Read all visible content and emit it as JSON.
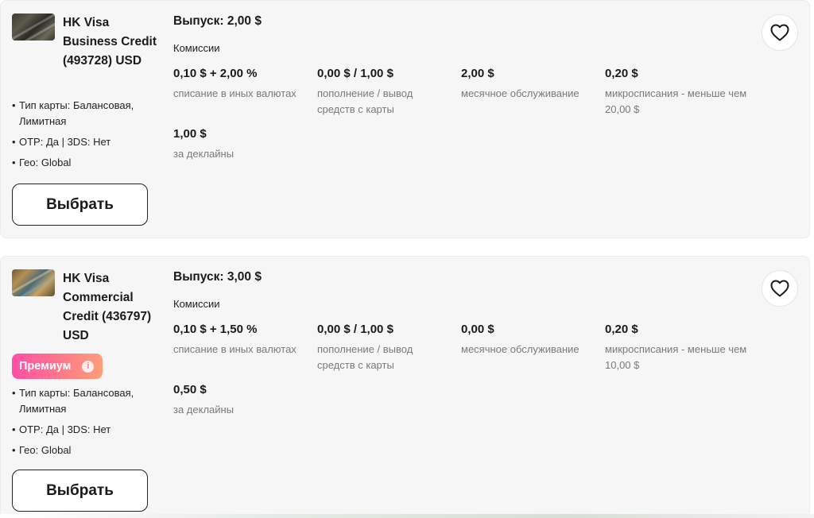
{
  "cards": [
    {
      "title": "HK Visa Business Credit (493728) USD",
      "thumbnail": "card-art-dark-figures",
      "bullets": [
        "Тип карты: Балансовая, Лимитная",
        "OTP: Да | 3DS: Нет",
        "Гео: Global"
      ],
      "select_label": "Выбрать",
      "issue": "Выпуск: 2,00 $",
      "fees_label": "Комиссии",
      "fees": [
        {
          "value": "0,10 $ + 2,00 %",
          "desc": "списание в иных валютах"
        },
        {
          "value": "0,00 $ / 1,00 $",
          "desc": "пополнение / вывод средств с карты"
        },
        {
          "value": "2,00 $",
          "desc": "месячное обслуживание"
        },
        {
          "value": "0,20 $",
          "desc": "микросписания - меньше чем 20,00 $"
        },
        {
          "value": "1,00 $",
          "desc": "за деклайны"
        }
      ],
      "favorite_icon": "heart-outline-icon"
    },
    {
      "title": "HK Visa Commercial Credit (436797) USD",
      "thumbnail": "card-art-golden-abstract",
      "badge": "Премиум",
      "badge_info": "i",
      "bullets": [
        "Тип карты: Балансовая, Лимитная",
        "OTP: Да | 3DS: Нет",
        "Гео: Global"
      ],
      "select_label": "Выбрать",
      "issue": "Выпуск: 3,00 $",
      "fees_label": "Комиссии",
      "fees": [
        {
          "value": "0,10 $ + 1,50 %",
          "desc": "списание в иных валютах"
        },
        {
          "value": "0,00 $ / 1,00 $",
          "desc": "пополнение / вывод средств с карты"
        },
        {
          "value": "0,00 $",
          "desc": "месячное обслуживание"
        },
        {
          "value": "0,20 $",
          "desc": "микросписания - меньше чем 10,00 $"
        },
        {
          "value": "0,50 $",
          "desc": "за деклайны"
        }
      ],
      "favorite_icon": "heart-outline-icon"
    }
  ],
  "colors": {
    "card_bg": "#f6f6f6",
    "premium_gradient_start": "#ff4fa6",
    "premium_gradient_end": "#ff9e7a",
    "muted_text": "#7a7a7a"
  }
}
